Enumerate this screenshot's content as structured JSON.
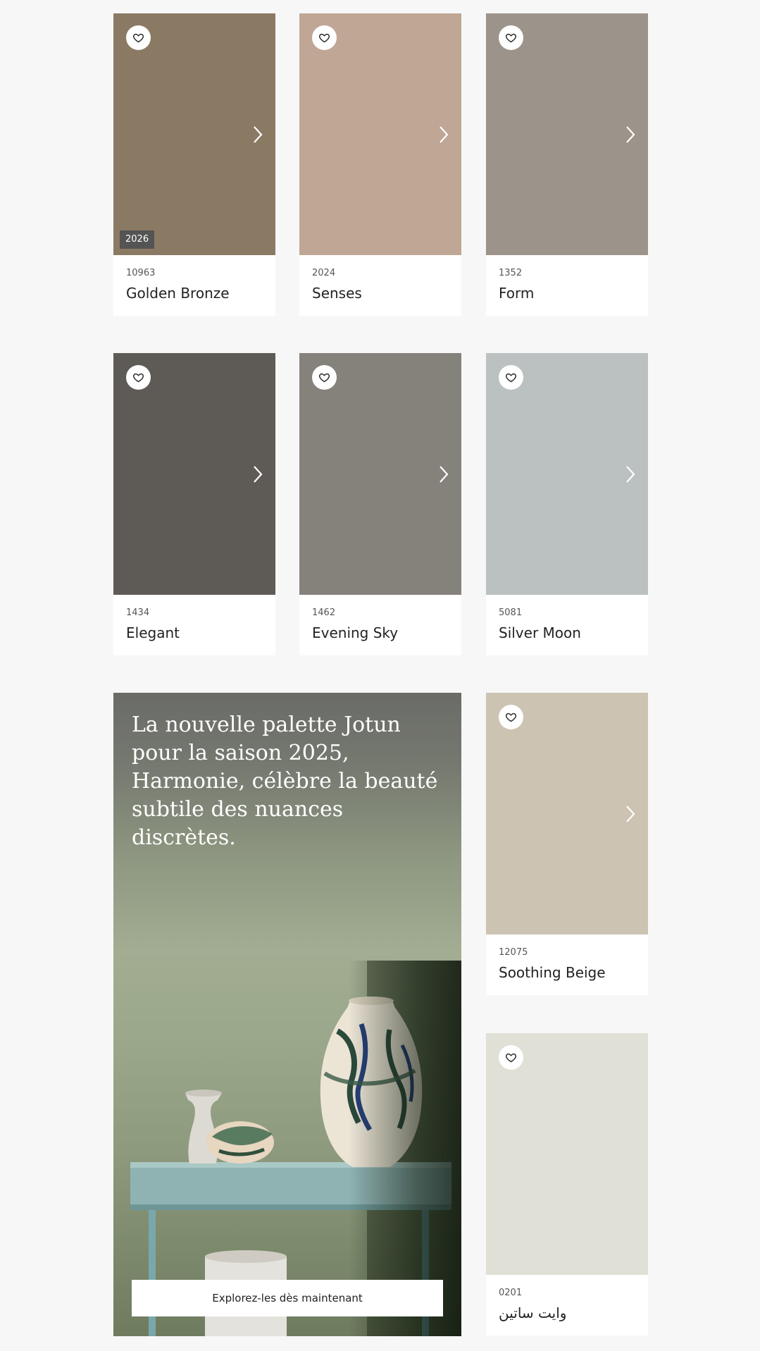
{
  "cards": [
    {
      "code": "10963",
      "name": "Golden Bronze",
      "color": "#8b7a63",
      "badge": "2026"
    },
    {
      "code": "2024",
      "name": "Senses",
      "color": "#c0a695"
    },
    {
      "code": "1352",
      "name": "Form",
      "color": "#9c948a"
    },
    {
      "code": "1434",
      "name": "Elegant",
      "color": "#5e5b56"
    },
    {
      "code": "1462",
      "name": "Evening Sky",
      "color": "#85817b"
    },
    {
      "code": "5081",
      "name": "Silver Moon",
      "color": "#bbc1c1"
    },
    {
      "code": "12075",
      "name": "Soothing Beige",
      "color": "#ccc3b2"
    },
    {
      "code": "0201",
      "name": "وايت ساتين",
      "color": "#e1e0d6"
    }
  ],
  "promo": {
    "text": "La nouvelle palette Jotun pour la saison 2025, Harmonie, célèbre la beauté subtile des nuances discrètes.",
    "button_label": "Explorez-les dès maintenant"
  },
  "icons": {
    "favorite": "heart-outline-icon",
    "next": "chevron-right-icon"
  }
}
